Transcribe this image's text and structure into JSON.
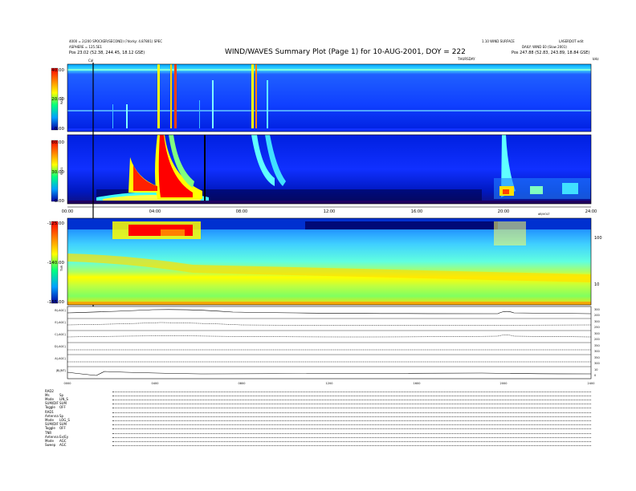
{
  "header": {
    "left_line1": "4000 = 2(200 SPOCKER/SECOND) (?dorky: 4.87801) SPEC",
    "left_line2": "ASPHERE = 125.5E1",
    "left_pos": "Pos 23.02 (52.38, 244.45, 18.12 GSE)",
    "title": "WIND/WAVES Summary Plot (Page 1) for 10-AUG-2001, DOY = 222",
    "right_line1": "1.10 WIND SURFACE",
    "right_line2": "DAILY: WIND E0 (Slow 2001)",
    "right_code": "LASERDOT edit",
    "right_pos": "Pos 247.88 (52.83, 243.89, 18.84 GSE)",
    "top_units": "THURSDAY",
    "top_right_units": "kHz",
    "marker_label": "Cal"
  },
  "panels": {
    "rad2": {
      "label": "RAD2",
      "yticks": [
        "40.00",
        "20.00",
        "0.00"
      ]
    },
    "rad1": {
      "label": "RAD1",
      "yticks": [
        "60.00",
        "30.00",
        "0.00"
      ]
    },
    "tnr": {
      "label": "TNR",
      "yticks": [
        "-125.00",
        "-140.00",
        "-155.00"
      ],
      "right_label": "dB/VOLT",
      "right_ticks": [
        "100",
        "10"
      ]
    },
    "time_ticks_a": [
      "00:00",
      "04:00",
      "08:00",
      "12:00",
      "16:00",
      "20:00",
      "24:00"
    ],
    "time_ticks_b": [
      "0000",
      "0400",
      "0800",
      "1200",
      "1600",
      "2000",
      "2400"
    ]
  },
  "lines": [
    {
      "label": "B(-AGC)",
      "r1": "300",
      "r2": "200"
    },
    {
      "label": "E(-AGC)",
      "r1": "300",
      "r2": "250"
    },
    {
      "label": "C(-AGC)",
      "r1": "300",
      "r2": "200"
    },
    {
      "label": "D(-AGC)",
      "r1": "350",
      "r2": "300"
    },
    {
      "label": "A(-AGC)",
      "r1": "350",
      "r2": "300"
    },
    {
      "label": "|B|(NT)",
      "r1": "10",
      "r2": "0"
    }
  ],
  "footer": [
    {
      "k": "RAD2",
      "v": ""
    },
    {
      "k": "Ms",
      "v": "Sp"
    },
    {
      "k": "Mode",
      "v": "LIN_S"
    },
    {
      "k": "SUM/DIF",
      "v": "SUM"
    },
    {
      "k": "Toggle",
      "v": "OFF"
    },
    {
      "k": "RAD1",
      "v": ""
    },
    {
      "k": "Antenna",
      "v": "Sp"
    },
    {
      "k": "Mode",
      "v": "LOG_S"
    },
    {
      "k": "SUM/DIF",
      "v": "SUM"
    },
    {
      "k": "Toggle",
      "v": "OFF"
    },
    {
      "k": "TNR",
      "v": ""
    },
    {
      "k": "Antenna",
      "v": "Ex/Ey"
    },
    {
      "k": "Mode",
      "v": "AGC"
    },
    {
      "k": "Sweep",
      "v": "AGC"
    }
  ],
  "chart_data": {
    "type": "heatmap",
    "title": "WIND/WAVES Summary Plot (Page 1) for 10-AUG-2001, DOY = 222",
    "xlim": [
      "00:00",
      "24:00"
    ],
    "panels": [
      {
        "name": "RAD2",
        "ylim": [
          0,
          40
        ]
      },
      {
        "name": "RAD1",
        "ylim": [
          0,
          60
        ]
      },
      {
        "name": "TNR",
        "ylim": [
          -155,
          -125
        ]
      }
    ],
    "colormap": [
      "#000080",
      "#0000ff",
      "#00a0ff",
      "#00ffff",
      "#80ff80",
      "#ffff00",
      "#ff8000",
      "#ff0000"
    ]
  }
}
